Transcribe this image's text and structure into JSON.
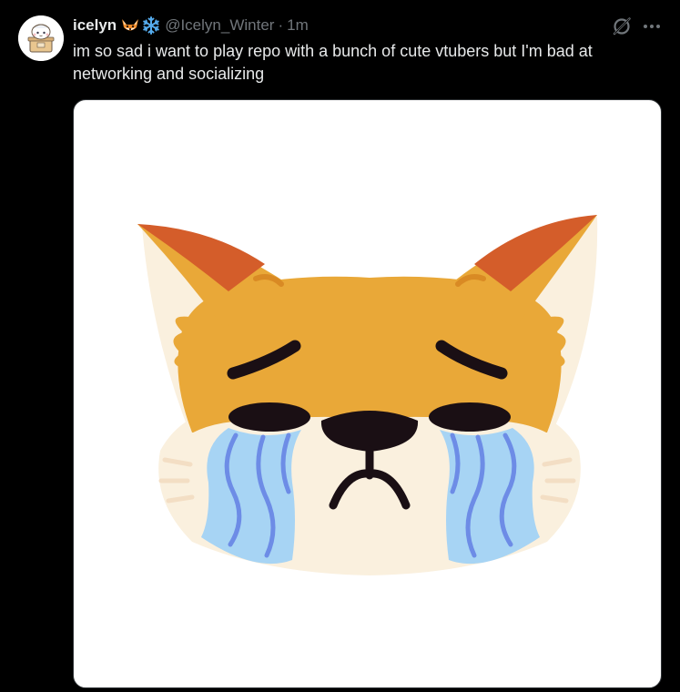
{
  "tweet": {
    "author": {
      "display_name": "icelyn",
      "handle": "@Icelyn_Winter",
      "badges": [
        "fox-emoji",
        "snowflake-emoji"
      ],
      "avatar": "chibi-character-avatar"
    },
    "separator": "·",
    "timestamp": "1m",
    "text": "im so sad i want to play repo with a bunch of cute vtubers but I'm bad at networking and socializing",
    "actions": {
      "grok_icon": "grok-slash-circle-icon",
      "more_icon": "ellipsis-icon"
    },
    "media": {
      "type": "image",
      "subject": "crying-fox-emoji",
      "colors": {
        "fur": "#E9A838",
        "ear_inner": "#D45D2A",
        "cream": "#FAF0DE",
        "features": "#1A0F14",
        "tears": "#A7D4F4",
        "tear_lines": "#6D8CE6"
      }
    }
  },
  "theme": {
    "background": "#000000",
    "text_primary": "#e7e9ea",
    "text_secondary": "#71767b"
  }
}
